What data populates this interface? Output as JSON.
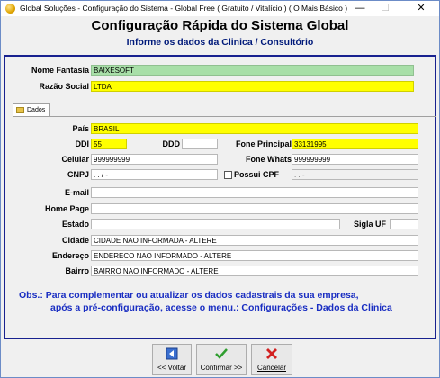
{
  "window": {
    "title": "Global Soluções - Configuração do Sistema - Global Free ( Gratuito / Vitalício ) ( O Mais Básico )",
    "minimize": "—",
    "maximize": "☐",
    "close": "✕"
  },
  "header": {
    "title": "Configuração Rápida do Sistema Global",
    "subtitle": "Informe os dados da Clinica / Consultório"
  },
  "company": {
    "nome_fantasia_label": "Nome Fantasia",
    "nome_fantasia_value": "BAIXESOFT",
    "razao_social_label": "Razão Social",
    "razao_social_value": "LTDA"
  },
  "tab": {
    "label": "Dados"
  },
  "form": {
    "pais_label": "País",
    "pais_value": "BRASIL",
    "ddi_label": "DDI",
    "ddi_value": "55",
    "ddd_label": "DDD",
    "ddd_value": "",
    "fone_principal_label": "Fone Principal",
    "fone_principal_value": "33131995",
    "celular_label": "Celular",
    "celular_value": "999999999",
    "fone_whats_label": "Fone Whats",
    "fone_whats_value": "999999999",
    "cnpj_label": "CNPJ",
    "cnpj_value": "  .  .  /   -",
    "possui_cpf_label": "Possui CPF",
    "cpf_value": "  .  .  -",
    "email_label": "E-mail",
    "email_value": "",
    "homepage_label": "Home Page",
    "homepage_value": "",
    "estado_label": "Estado",
    "estado_value": "",
    "sigla_uf_label": "Sigla UF",
    "sigla_uf_value": "",
    "cidade_label": "Cidade",
    "cidade_value": "CIDADE NAO INFORMADA - ALTERE",
    "endereco_label": "Endereço",
    "endereco_value": "ENDERECO NAO INFORMADO - ALTERE",
    "bairro_label": "Bairro",
    "bairro_value": "BAIRRO NAO INFORMADO - ALTERE"
  },
  "obs": {
    "line1": "Obs.: Para complementar  ou atualizar os dados cadastrais da sua empresa,",
    "line2": "após a pré-configuração, acesse o menu.: Configurações - Dados da Clinica"
  },
  "buttons": {
    "voltar": "<< Voltar",
    "confirmar": "Confirmar >>",
    "cancelar": "Cancelar"
  },
  "colors": {
    "required_field": "#ffff00",
    "highlight_field": "#a8dfa8",
    "accent": "#1a2ec2"
  }
}
